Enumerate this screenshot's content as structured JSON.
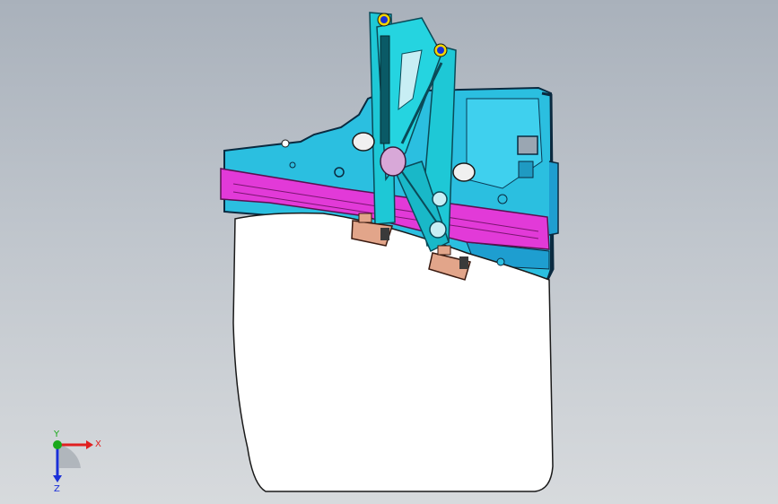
{
  "app": {
    "view": "CAD 3D viewport"
  },
  "model": {
    "description_colors": {
      "glass": "#ffffff",
      "rail": "#1ec8d6",
      "rail_dark": "#0a6a78",
      "door_panel": "#2bbfe0",
      "door_panel_dark": "#1585b0",
      "bracket_magenta": "#e23ad8",
      "clip": "#e2a58a",
      "pulley_blue": "#1a2fd8",
      "pulley_yellow": "#f2d400"
    }
  },
  "triad": {
    "x_label": "X",
    "y_label": "Y",
    "z_label": "Z",
    "x_color": "#e02020",
    "y_color": "#1aa81a",
    "z_color": "#1a2fd8"
  }
}
